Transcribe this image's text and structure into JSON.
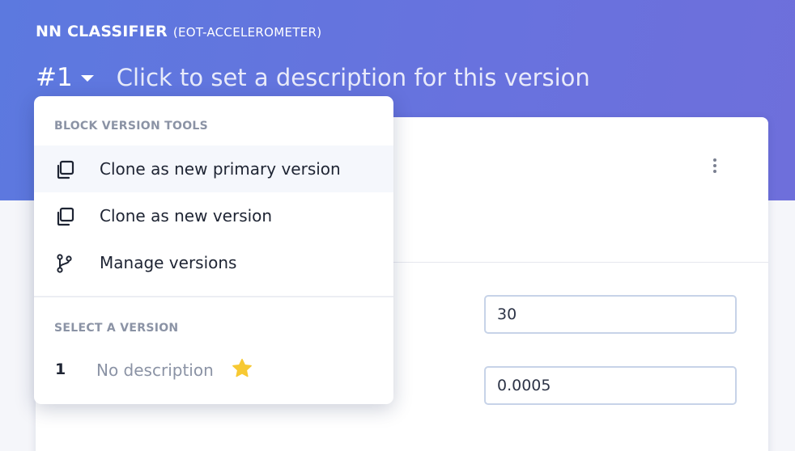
{
  "header": {
    "block_name": "NN CLASSIFIER",
    "block_subname": "(EOT-ACCELEROMETER)",
    "version_label": "#1",
    "version_description_placeholder": "Click to set a description for this version"
  },
  "dropdown": {
    "tools_heading": "BLOCK VERSION TOOLS",
    "items": [
      {
        "label": "Clone as new primary version",
        "icon": "clone-icon",
        "highlighted": true
      },
      {
        "label": "Clone as new version",
        "icon": "clone-icon",
        "highlighted": false
      },
      {
        "label": "Manage versions",
        "icon": "git-branch-icon",
        "highlighted": false
      }
    ],
    "select_heading": "SELECT A VERSION",
    "versions": [
      {
        "number": "1",
        "description": "No description",
        "primary": true,
        "icon": "star-icon"
      }
    ]
  },
  "form": {
    "fields": [
      {
        "value": "30"
      },
      {
        "value": "0.0005"
      }
    ]
  },
  "colors": {
    "header_gradient_start": "#5c79df",
    "header_gradient_end": "#6e6fdb",
    "star": "#f7c933",
    "muted_text": "#8b93a5",
    "input_border": "#c7d3e8"
  }
}
